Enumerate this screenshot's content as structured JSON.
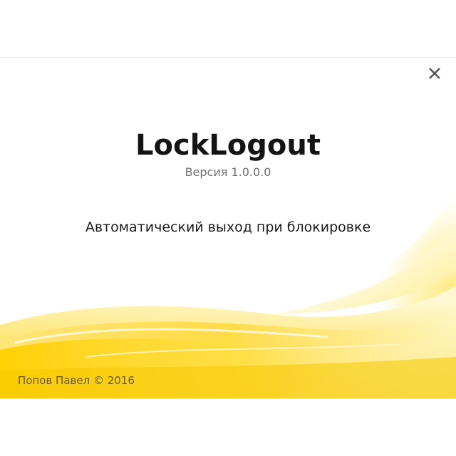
{
  "window": {
    "close_label": "x"
  },
  "app": {
    "title": "LockLogout",
    "version": "Версия 1.0.0.0",
    "description": "Автоматический выход при блокировке"
  },
  "footer": {
    "copyright": "Попов Павел © 2016"
  },
  "colors": {
    "accent_yellow": "#f7c800",
    "light_yellow": "#fff3a8",
    "title_text": "#141414",
    "muted_text": "#6e6e6e"
  },
  "icons": {
    "close": "close-icon"
  }
}
